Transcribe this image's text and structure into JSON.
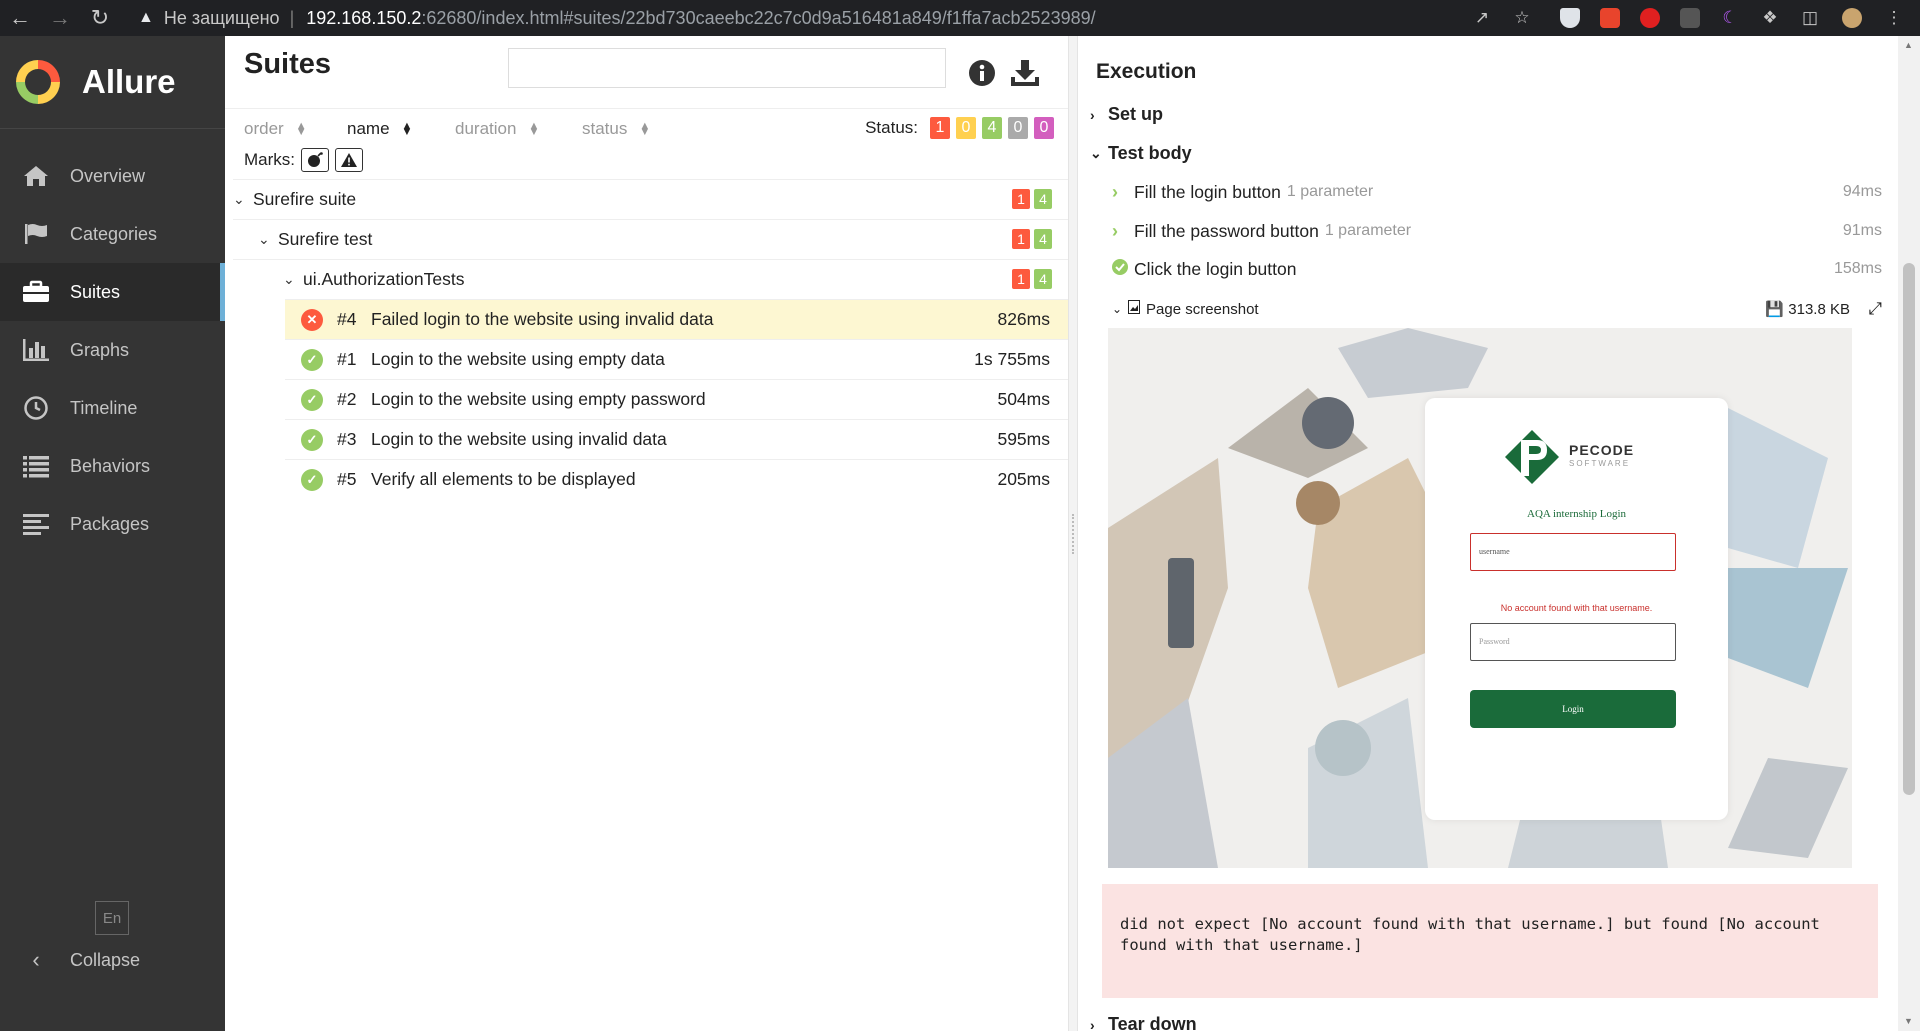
{
  "browser": {
    "security_label": "Не защищено",
    "url_host": "192.168.150.2",
    "url_rest": ":62680/index.html#suites/22bd730caeebc22c7c0d9a516481a849/f1ffa7acb2523989/"
  },
  "sidebar": {
    "brand": "Allure",
    "items": [
      {
        "label": "Overview",
        "icon": "home-icon"
      },
      {
        "label": "Categories",
        "icon": "flag-icon"
      },
      {
        "label": "Suites",
        "icon": "briefcase-icon"
      },
      {
        "label": "Graphs",
        "icon": "bar-chart-icon"
      },
      {
        "label": "Timeline",
        "icon": "clock-icon"
      },
      {
        "label": "Behaviors",
        "icon": "list-icon"
      },
      {
        "label": "Packages",
        "icon": "align-left-icon"
      }
    ],
    "active_item": "Suites",
    "language": "En",
    "collapse_label": "Collapse"
  },
  "suites": {
    "title": "Suites",
    "search_value": "",
    "sort": {
      "order": "order",
      "name": "name",
      "duration": "duration",
      "status": "status"
    },
    "status_label": "Status:",
    "status_counts": {
      "failed": "1",
      "broken": "0",
      "passed": "4",
      "skipped": "0",
      "unknown": "0"
    },
    "marks_label": "Marks:",
    "tree": {
      "suite": {
        "label": "Surefire suite",
        "failed": "1",
        "passed": "4"
      },
      "test": {
        "label": "Surefire test",
        "failed": "1",
        "passed": "4"
      },
      "class": {
        "label": "ui.AuthorizationTests",
        "failed": "1",
        "passed": "4"
      }
    },
    "cases": [
      {
        "num": "#4",
        "name": "Failed login to the website using invalid data",
        "duration": "826ms",
        "status": "failed"
      },
      {
        "num": "#1",
        "name": "Login to the website using empty data",
        "duration": "1s 755ms",
        "status": "passed"
      },
      {
        "num": "#2",
        "name": "Login to the website using empty password",
        "duration": "504ms",
        "status": "passed"
      },
      {
        "num": "#3",
        "name": "Login to the website using invalid data",
        "duration": "595ms",
        "status": "passed"
      },
      {
        "num": "#5",
        "name": "Verify all elements to be displayed",
        "duration": "205ms",
        "status": "passed"
      }
    ]
  },
  "execution": {
    "title": "Execution",
    "setup": "Set up",
    "test_body": "Test body",
    "steps": [
      {
        "name": "Fill the login button",
        "param": "1 parameter",
        "duration": "94ms"
      },
      {
        "name": "Fill the password button",
        "param": "1 parameter",
        "duration": "91ms"
      },
      {
        "name": "Click the login button",
        "param": "",
        "duration": "158ms"
      }
    ],
    "attachment": {
      "name": "Page screenshot",
      "size": "313.8 KB"
    },
    "screenshot": {
      "brand": "PECODE",
      "brand_sub": "SOFTWARE",
      "title": "AQA internship Login",
      "username_value": "username",
      "error_text": "No account found with that username.",
      "password_placeholder": "Password",
      "login_label": "Login"
    },
    "error_message": "did not expect [No account found with that username.] but found [No account found with that username.]",
    "teardown": "Tear down"
  },
  "colors": {
    "failed": "#fd5a3e",
    "broken": "#ffd050",
    "passed": "#97cc64",
    "skipped": "#aaaaaa",
    "unknown": "#d35ebe",
    "sidebar": "#343434",
    "accent": "#6eb0d7"
  }
}
